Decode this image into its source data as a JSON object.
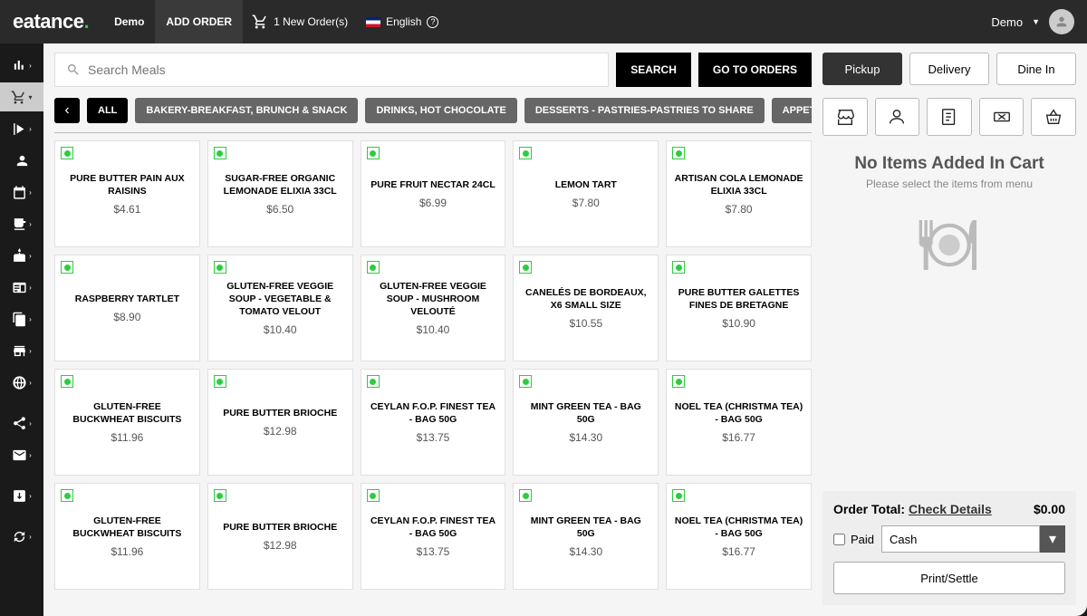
{
  "brand": "eatance",
  "topnav": {
    "demo": "Demo",
    "add_order": "ADD ORDER",
    "new_order": "1 New Order(s)",
    "lang": "English",
    "user": "Demo"
  },
  "search": {
    "placeholder": "Search Meals",
    "btn_search": "SEARCH",
    "btn_orders": "GO TO ORDERS"
  },
  "categories": [
    "ALL",
    "BAKERY-BREAKFAST, BRUNCH & SNACK",
    "DRINKS, HOT CHOCOLATE",
    "DESSERTS - PASTRIES-PASTRIES TO SHARE",
    "APPETIZERS"
  ],
  "products": [
    {
      "name": "PURE BUTTER PAIN AUX RAISINS",
      "price": "$4.61"
    },
    {
      "name": "SUGAR-FREE ORGANIC LEMONADE ELIXIA 33CL",
      "price": "$6.50"
    },
    {
      "name": "PURE FRUIT NECTAR 24CL",
      "price": "$6.99"
    },
    {
      "name": "LEMON TART",
      "price": "$7.80"
    },
    {
      "name": "ARTISAN COLA LEMONADE ELIXIA 33CL",
      "price": "$7.80"
    },
    {
      "name": "RASPBERRY TARTLET",
      "price": "$8.90"
    },
    {
      "name": "GLUTEN-FREE VEGGIE SOUP - VEGETABLE & TOMATO VELOUT",
      "price": "$10.40"
    },
    {
      "name": "GLUTEN-FREE VEGGIE SOUP - MUSHROOM VELOUTÉ",
      "price": "$10.40"
    },
    {
      "name": "CANELÉS DE BORDEAUX, X6 SMALL SIZE",
      "price": "$10.55"
    },
    {
      "name": "PURE BUTTER GALETTES FINES DE BRETAGNE",
      "price": "$10.90"
    },
    {
      "name": "GLUTEN-FREE BUCKWHEAT BISCUITS",
      "price": "$11.96"
    },
    {
      "name": "PURE BUTTER BRIOCHE",
      "price": "$12.98"
    },
    {
      "name": "CEYLAN F.O.P. FINEST TEA - BAG 50G",
      "price": "$13.75"
    },
    {
      "name": "MINT GREEN TEA - BAG 50G",
      "price": "$14.30"
    },
    {
      "name": "NOEL TEA (CHRISTMA TEA) - BAG 50G",
      "price": "$16.77"
    },
    {
      "name": "GLUTEN-FREE BUCKWHEAT BISCUITS",
      "price": "$11.96"
    },
    {
      "name": "PURE BUTTER BRIOCHE",
      "price": "$12.98"
    },
    {
      "name": "CEYLAN F.O.P. FINEST TEA - BAG 50G",
      "price": "$13.75"
    },
    {
      "name": "MINT GREEN TEA - BAG 50G",
      "price": "$14.30"
    },
    {
      "name": "NOEL TEA (CHRISTMA TEA) - BAG 50G",
      "price": "$16.77"
    }
  ],
  "service": {
    "pickup": "Pickup",
    "delivery": "Delivery",
    "dinein": "Dine In"
  },
  "cart": {
    "empty_title": "No Items Added In Cart",
    "empty_sub": "Please select the items from menu",
    "total_label": "Order Total:",
    "check_details": "Check Details",
    "total_value": "$0.00",
    "paid_label": "Paid",
    "payment_method": "Cash",
    "settle": "Print/Settle"
  }
}
